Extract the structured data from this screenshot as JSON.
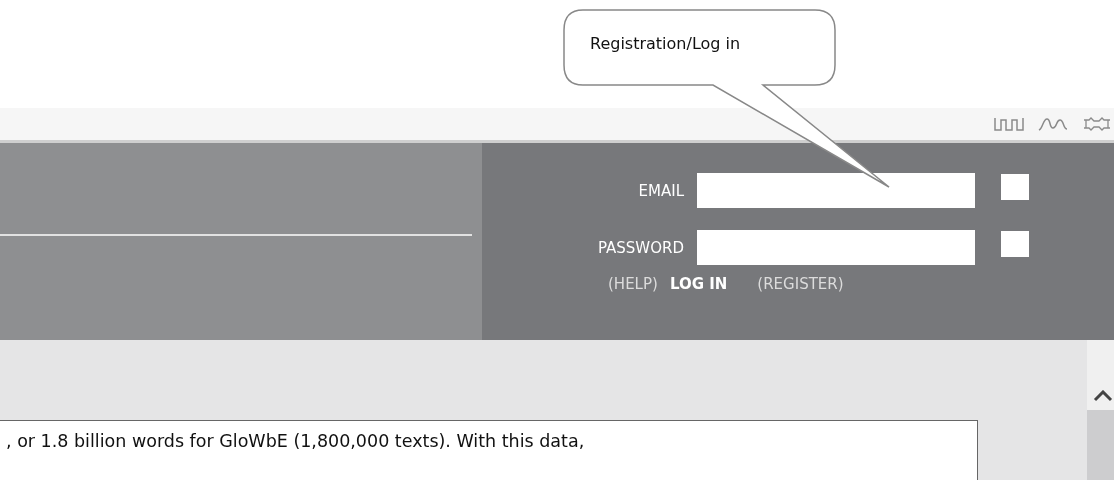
{
  "callout": {
    "text": "Registration/Log in"
  },
  "login": {
    "fields": [
      {
        "label": "EMAIL",
        "checked": false
      },
      {
        "label": "PASSWORD",
        "checked": false
      }
    ],
    "links": [
      {
        "text": "(HELP)",
        "kind": "plain"
      },
      {
        "text": "LOG IN",
        "kind": "strong"
      },
      {
        "text": "(REGISTER)",
        "kind": "plain"
      }
    ]
  },
  "content": {
    "text": ", or 1.8 billion words for GloWbE (1,800,000 texts). With this data,"
  }
}
